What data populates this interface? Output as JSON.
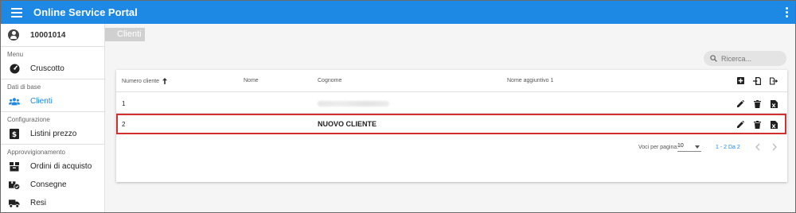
{
  "app": {
    "title": "Online Service Portal"
  },
  "user": {
    "id": "10001014"
  },
  "sidebar": {
    "sections": [
      {
        "label": "Menu",
        "items": [
          {
            "label": "Cruscotto",
            "icon": "dashboard-icon"
          }
        ]
      },
      {
        "label": "Dati di base",
        "items": [
          {
            "label": "Clienti",
            "icon": "people-icon",
            "active": true
          }
        ]
      },
      {
        "label": "Configurazione",
        "items": [
          {
            "label": "Listini prezzo",
            "icon": "price-list-icon"
          }
        ]
      },
      {
        "label": "Approvvigionamento",
        "items": [
          {
            "label": "Ordini di acquisto",
            "icon": "box-icon"
          },
          {
            "label": "Consegne",
            "icon": "delivery-check-icon"
          },
          {
            "label": "Resi",
            "icon": "truck-icon"
          }
        ]
      }
    ]
  },
  "page": {
    "title": "Clienti"
  },
  "search": {
    "placeholder": "Ricerca..."
  },
  "table": {
    "headers": {
      "number": "Numero cliente",
      "name": "Nome",
      "surname": "Cognome",
      "extra": "Nome aggiuntivo 1"
    },
    "rows": [
      {
        "number": "1",
        "name": "",
        "surname": "",
        "extra": ""
      },
      {
        "number": "2",
        "name": "",
        "surname": "NUOVO CLIENTE",
        "extra": ""
      }
    ]
  },
  "pagination": {
    "per_page_label": "Voci per pagina:",
    "per_page": "10",
    "range": "1 - 2 Da 2"
  },
  "colors": {
    "primary": "#1e88e5",
    "highlight": "#d32f2f"
  }
}
